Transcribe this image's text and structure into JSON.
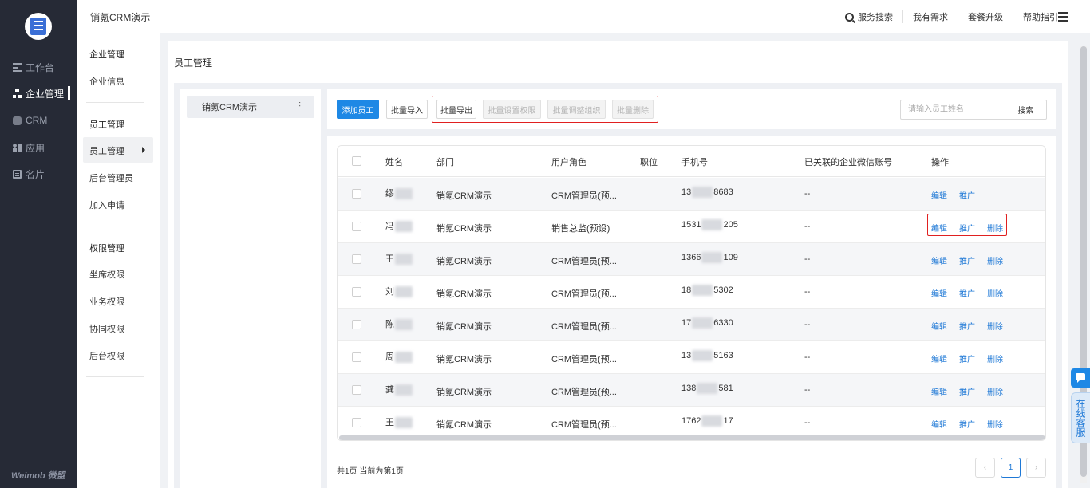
{
  "sidebar": {
    "brand": "Weimob 微盟",
    "items": [
      {
        "label": "工作台",
        "icon": "dashboard-icon"
      },
      {
        "label": "企业管理",
        "icon": "org-tree-icon"
      },
      {
        "label": "CRM",
        "icon": "crm-icon"
      },
      {
        "label": "应用",
        "icon": "apps-icon"
      },
      {
        "label": "名片",
        "icon": "card-icon"
      }
    ]
  },
  "header": {
    "title": "销氪CRM演示",
    "links": [
      "服务搜索",
      "我有需求",
      "套餐升级",
      "帮助指引"
    ]
  },
  "submenu": {
    "enterprise_group": "企业管理",
    "enterprise_info": "企业信息",
    "staff_group": "员工管理",
    "staff_manage": "员工管理",
    "admin": "后台管理员",
    "join": "加入申请",
    "perm_group": "权限管理",
    "seat_perm": "坐席权限",
    "biz_perm": "业务权限",
    "collab_perm": "协同权限",
    "backend_perm": "后台权限"
  },
  "page": {
    "title": "员工管理",
    "org_name": "销氪CRM演示",
    "org_more": "..."
  },
  "toolbar": {
    "add": "添加员工",
    "import": "批量导入",
    "export": "批量导出",
    "set_perm": "批量设置权限",
    "adjust_org": "批量调整组织",
    "delete": "批量删除",
    "search_placeholder": "请输入员工姓名",
    "search_btn": "搜索"
  },
  "table": {
    "headers": {
      "name": "姓名",
      "dept": "部门",
      "role": "用户角色",
      "position": "职位",
      "phone": "手机号",
      "wechat": "已关联的企业微信账号",
      "ops": "操作"
    },
    "rows": [
      {
        "name": "缪",
        "dept": "销氪CRM演示",
        "role": "CRM管理员(预...",
        "phone_a": "13",
        "phone_b": "8683",
        "wechat": "--",
        "ops": [
          "编辑",
          "推广"
        ]
      },
      {
        "name": "冯",
        "dept": "销氪CRM演示",
        "role": "销售总监(预设)",
        "phone_a": "1531",
        "phone_b": "205",
        "wechat": "--",
        "ops": [
          "编辑",
          "推广",
          "删除"
        ]
      },
      {
        "name": "王",
        "dept": "销氪CRM演示",
        "role": "CRM管理员(预...",
        "phone_a": "1366",
        "phone_b": "109",
        "wechat": "--",
        "ops": [
          "编辑",
          "推广",
          "删除"
        ]
      },
      {
        "name": "刘",
        "dept": "销氪CRM演示",
        "role": "CRM管理员(预...",
        "phone_a": "18",
        "phone_b": "5302",
        "wechat": "--",
        "ops": [
          "编辑",
          "推广",
          "删除"
        ]
      },
      {
        "name": "陈",
        "dept": "销氪CRM演示",
        "role": "CRM管理员(预...",
        "phone_a": "17",
        "phone_b": "6330",
        "wechat": "--",
        "ops": [
          "编辑",
          "推广",
          "删除"
        ]
      },
      {
        "name": "周",
        "dept": "销氪CRM演示",
        "role": "CRM管理员(预...",
        "phone_a": "13",
        "phone_b": "5163",
        "wechat": "--",
        "ops": [
          "编辑",
          "推广",
          "删除"
        ]
      },
      {
        "name": "龚",
        "dept": "销氪CRM演示",
        "role": "CRM管理员(预...",
        "phone_a": "138",
        "phone_b": "581",
        "wechat": "--",
        "ops": [
          "编辑",
          "推广",
          "删除"
        ]
      },
      {
        "name": "王",
        "dept": "销氪CRM演示",
        "role": "CRM管理员(预...",
        "phone_a": "1762",
        "phone_b": "17",
        "wechat": "--",
        "ops": [
          "编辑",
          "推广",
          "删除"
        ]
      }
    ]
  },
  "pager": {
    "info": "共1页 当前为第1页",
    "prev": "‹",
    "current": "1",
    "next": "›"
  },
  "float": {
    "online_service": "在线客服"
  },
  "colors": {
    "nav_bg": "#262a36",
    "primary": "#1e88e5",
    "link": "#1e78d6",
    "highlight_box": "#e02020"
  }
}
